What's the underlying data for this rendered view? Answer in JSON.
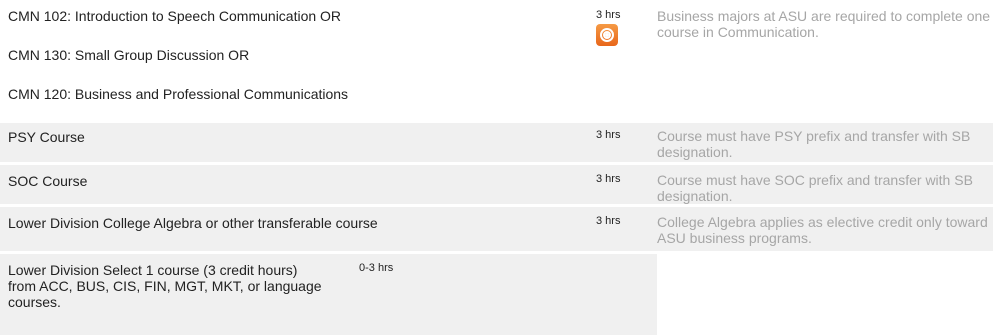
{
  "rows": [
    {
      "courses": [
        "CMN 102: Introduction to Speech Communication OR",
        "CMN 130: Small Group Discussion OR",
        "CMN 120: Business and Professional Communications"
      ],
      "hours": "3 hrs",
      "note": "Business majors at ASU are required to complete one course in Communication."
    },
    {
      "courses": [
        "PSY Course"
      ],
      "hours": "3 hrs",
      "note": "Course must have PSY prefix and transfer with SB designation."
    },
    {
      "courses": [
        "SOC Course"
      ],
      "hours": "3 hrs",
      "note": "Course must have SOC prefix and transfer with SB designation."
    },
    {
      "courses": [
        "Lower Division College Algebra or other transferable course"
      ],
      "hours": "3 hrs",
      "note": "College Algebra applies as elective credit only toward ASU business programs."
    },
    {
      "courses": [
        "Lower Division Select 1 course (3 credit hours) from ACC, BUS, CIS, FIN, MGT, MKT, or language courses."
      ],
      "hours": "0-3 hrs",
      "note": ""
    }
  ],
  "icons": {
    "row_0_badge": "rss-icon"
  },
  "colors": {
    "row_shade": "#f0f0f0",
    "note_text": "#a6a6a6",
    "icon_orange": "#f07f2a"
  }
}
